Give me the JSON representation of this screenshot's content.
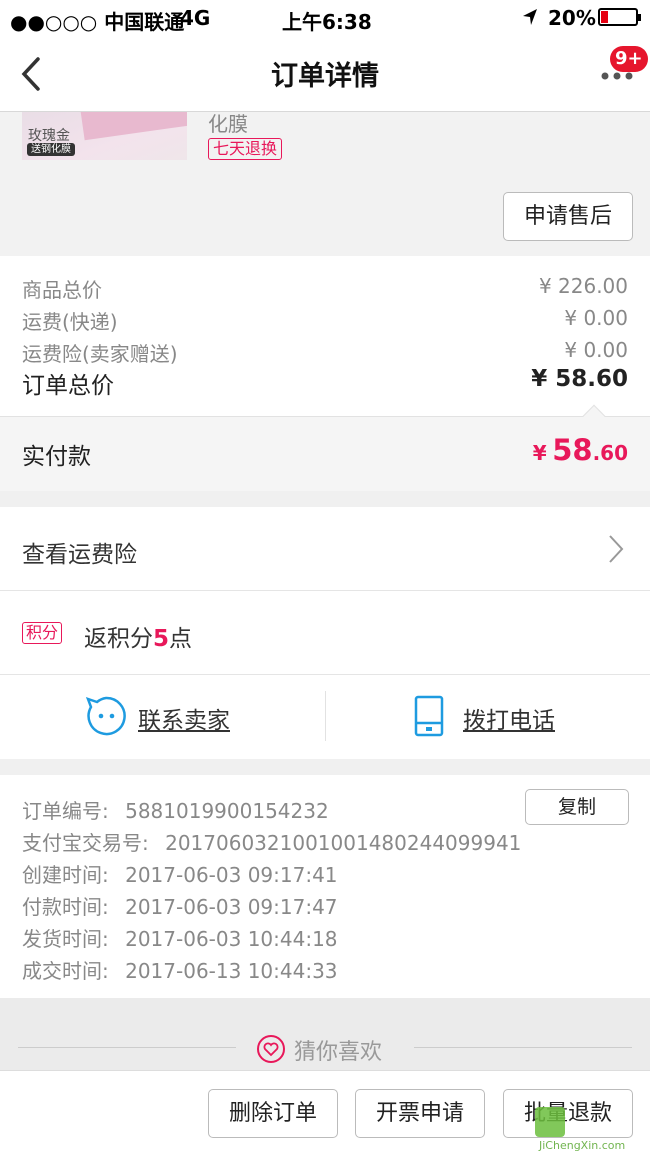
{
  "status_bar": {
    "carrier": "●●○○○ 中国联通",
    "network": "4G",
    "time": "上午6:38",
    "battery": "20%"
  },
  "navbar": {
    "title": "订单详情",
    "badge": "9+"
  },
  "product": {
    "thumb_text": "玫瑰金",
    "thumb_tag": "送钢化膜",
    "name_tail": "化膜",
    "return_tag": "七天退换",
    "after_sale_button": "申请售后"
  },
  "prices": {
    "items": [
      {
        "label": "商品总价",
        "value": "¥ 226.00"
      },
      {
        "label": "运费(快递)",
        "value": "¥ 0.00"
      },
      {
        "label": "运费险(卖家赠送)",
        "value": "¥ 0.00"
      }
    ],
    "total_label": "订单总价",
    "total_value": "¥ 58.60",
    "paid_label": "实付款",
    "paid_currency": "¥",
    "paid_int": "58",
    "paid_dec": ".60"
  },
  "insurance": {
    "label": "查看运费险"
  },
  "points": {
    "badge": "积分",
    "text_prefix": "返积分",
    "number": "5",
    "text_suffix": "点"
  },
  "contact": {
    "seller_label": "联系卖家",
    "phone_label": "拨打电话"
  },
  "order_info": {
    "copy_button": "复制",
    "rows": [
      {
        "label": "订单编号:",
        "value": "5881019900154232"
      },
      {
        "label": "支付宝交易号:",
        "value": "2017060321001001480244099941"
      },
      {
        "label": "创建时间:",
        "value": "2017-06-03 09:17:41"
      },
      {
        "label": "付款时间:",
        "value": "2017-06-03 09:17:47"
      },
      {
        "label": "发货时间:",
        "value": "2017-06-03 10:44:18"
      },
      {
        "label": "成交时间:",
        "value": "2017-06-13 10:44:33"
      }
    ]
  },
  "guess": {
    "label": "猜你喜欢"
  },
  "bottom_bar": {
    "delete": "删除订单",
    "invoice": "开票申请",
    "refund": "批量退款"
  },
  "watermark": {
    "text": "JiChengXin.com"
  },
  "colors": {
    "accent": "#e8185a",
    "link_blue": "#1e9be0",
    "muted": "#888888",
    "page_bg": "#f0f0f0"
  }
}
